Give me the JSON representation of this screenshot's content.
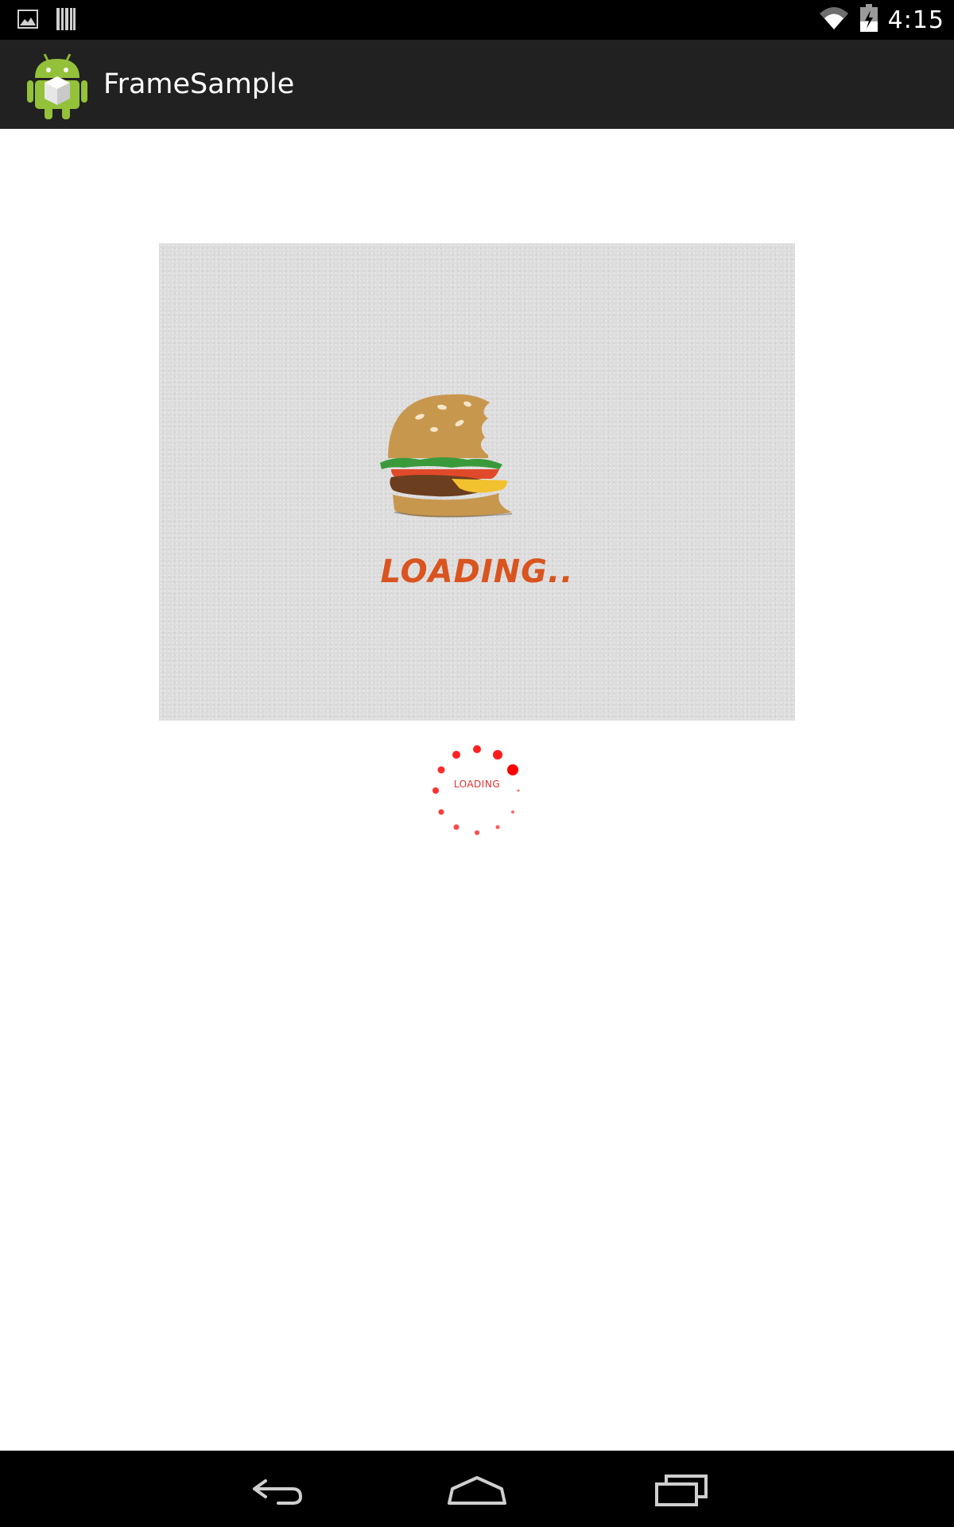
{
  "status_bar": {
    "time": "4:15",
    "left_icons": [
      "gallery-notification-icon",
      "barcode-notification-icon"
    ],
    "right_icons": [
      "wifi-icon",
      "battery-charging-icon"
    ]
  },
  "action_bar": {
    "title": "FrameSample",
    "icon": "android-app-icon"
  },
  "main": {
    "frame_image": {
      "icon": "burger-illustration",
      "text": "LOADING.."
    },
    "spinner": {
      "text": "LOADING",
      "color": "#e53030"
    }
  },
  "nav_bar": {
    "buttons": [
      "back-icon",
      "home-icon",
      "recent-apps-icon"
    ]
  },
  "colors": {
    "status_bar": "#000000",
    "action_bar": "#212121",
    "background": "#ffffff",
    "loading_text": "#d9541f"
  }
}
